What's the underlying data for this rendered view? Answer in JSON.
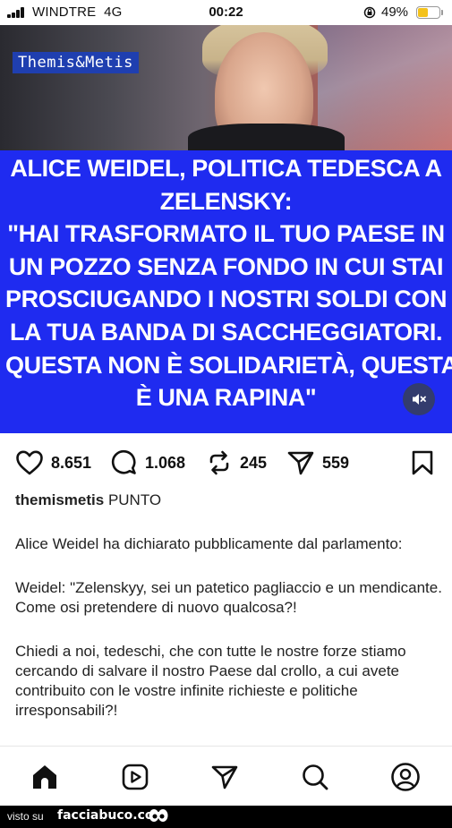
{
  "status_bar": {
    "carrier": "WINDTRE",
    "network": "4G",
    "time": "00:22",
    "battery_percent": "49%",
    "battery_level": 0.49,
    "battery_color": "#f4c21b"
  },
  "post": {
    "image": {
      "watermark": "Themis&Metis",
      "headline_lines": [
        "ALICE WEIDEL, POLITICA TEDESCA A",
        "ZELENSKY:",
        "\"HAI TRASFORMATO IL TUO PAESE IN",
        "UN POZZO SENZA FONDO IN CUI STAI",
        "PROSCIUGANDO I NOSTRI SOLDI CON",
        "LA TUA BANDA DI SACCHEGGIATORI.",
        "QUESTA NON È  SOLIDARIETÀ, QUESTA",
        "È  UNA RAPINA\""
      ],
      "background_color": "#1f2bf0",
      "mute_icon": "speaker-muted-icon"
    },
    "actions": {
      "likes": "8.651",
      "comments": "1.068",
      "reposts": "245",
      "shares": "559"
    },
    "caption": {
      "username": "themismetis",
      "tag": "PUNTO",
      "paragraphs": [
        "Alice Weidel ha dichiarato pubblicamente dal parlamento:",
        "Weidel: \"Zelenskyy, sei un patetico pagliaccio e un mendicante. Come osi pretendere di nuovo qualcosa?!",
        "Chiedi a noi, tedeschi, che con tutte le nostre forze stiamo cercando di salvare il nostro Paese dal crollo, a cui avete contribuito con le vostre infinite richieste e politiche irresponsabili?!"
      ]
    }
  },
  "bottom_nav": {
    "items": [
      "home-icon",
      "reels-icon",
      "send-icon",
      "search-icon",
      "profile-icon"
    ]
  },
  "footer": {
    "visto_su": "visto su",
    "site": "facciabuco.com"
  }
}
